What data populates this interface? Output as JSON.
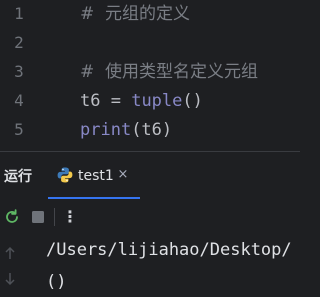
{
  "editor": {
    "lines": [
      {
        "number": "1",
        "comment": "#  元组的定义"
      },
      {
        "number": "2"
      },
      {
        "number": "3",
        "comment": "#  使用类型名定义元组"
      },
      {
        "number": "4",
        "var": "t6",
        "op": " = ",
        "func": "tuple",
        "args": "()"
      },
      {
        "number": "5",
        "func": "print",
        "args": "(t6)"
      }
    ]
  },
  "tool_window": {
    "title": "运行",
    "tab_label": "test1",
    "tab_close": "×",
    "more_glyph": "⋮"
  },
  "console": {
    "lines": [
      "/Users/lijiahao/Desktop/",
      "()"
    ]
  },
  "colors": {
    "background": "#1e1f22",
    "comment": "#7a7e85",
    "function": "#56a8f5",
    "builtin": "#8888c6",
    "accent": "#3574f0",
    "rerun_green": "#5fb865"
  },
  "icons": {
    "tab": "python-icon",
    "rerun": "rerun-icon",
    "stop": "stop-icon",
    "up": "arrow-up-icon",
    "down": "arrow-down-icon"
  }
}
